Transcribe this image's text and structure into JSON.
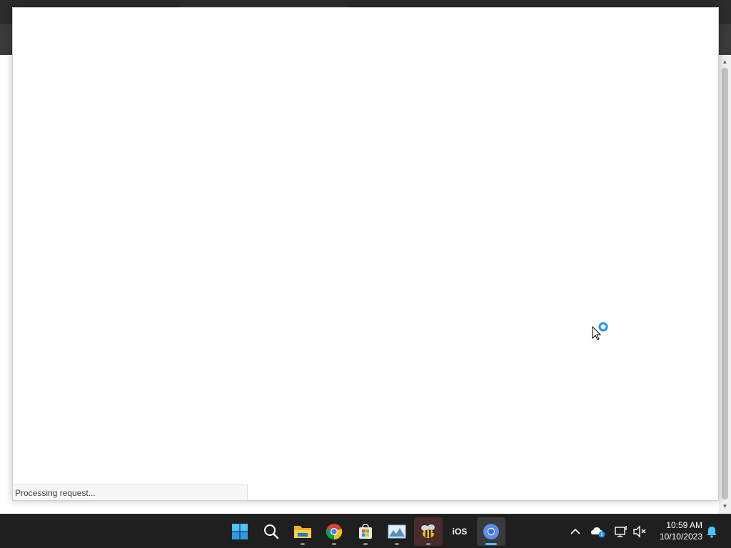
{
  "popup": {
    "status_text": "Processing request..."
  },
  "taskbar": {
    "apps": [
      {
        "name": "start-icon"
      },
      {
        "name": "search-icon"
      },
      {
        "name": "file-explorer-icon"
      },
      {
        "name": "chrome-icon"
      },
      {
        "name": "microsoft-store-icon"
      },
      {
        "name": "photos-icon"
      },
      {
        "name": "bee-app-icon"
      },
      {
        "name": "ios-app-icon",
        "label": "iOS"
      },
      {
        "name": "chromium-icon"
      }
    ],
    "tray": {
      "clock_time": "10:59 AM",
      "clock_date": "10/10/2023"
    }
  },
  "colors": {
    "taskbar_bg": "#1f1f1f",
    "accent": "#4cc2ff",
    "busy_ring": "#1e90ff"
  }
}
